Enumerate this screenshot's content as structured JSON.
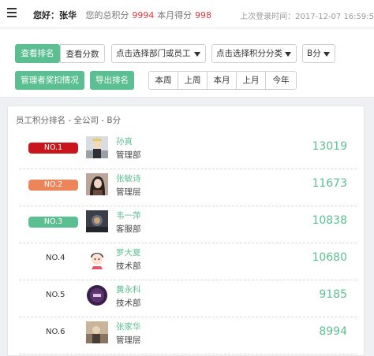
{
  "header": {
    "greeting": "您好：张华",
    "total_label": "您的总积分",
    "total_value": "9994",
    "month_label": "本月得分",
    "month_value": "998",
    "last_login": "上次登录时间：2017-12-07 16:59:5"
  },
  "toolbar": {
    "view_ranking": "查看排名",
    "view_scores": "查看分数",
    "dept_select": "点击选择部门或员工",
    "category_select": "点击选择积分分类",
    "grade_select": "B分",
    "manager_deduction": "管理者奖扣情况",
    "export_ranking": "导出排名",
    "periods": [
      "本周",
      "上周",
      "本月",
      "上月",
      "今年"
    ]
  },
  "panel": {
    "title": "员工积分排名 - 全公司 - B分"
  },
  "rankings": [
    {
      "rank": "NO.1",
      "name": "孙真",
      "dept": "管理部",
      "score": "13019",
      "badge_color": "#c9161d"
    },
    {
      "rank": "NO.2",
      "name": "张敏诗",
      "dept": "管理层",
      "score": "11673",
      "badge_color": "#ec8559"
    },
    {
      "rank": "NO.3",
      "name": "韦一萍",
      "dept": "客服部",
      "score": "10838",
      "badge_color": "#5cbf92"
    },
    {
      "rank": "NO.4",
      "name": "罗大夏",
      "dept": "技术部",
      "score": "10680"
    },
    {
      "rank": "NO.5",
      "name": "黄永科",
      "dept": "技术部",
      "score": "9185"
    },
    {
      "rank": "NO.6",
      "name": "张家华",
      "dept": "管理层",
      "score": "8994"
    }
  ],
  "colors": {
    "accent": "#5cbf92",
    "highlight": "#e0373a"
  }
}
